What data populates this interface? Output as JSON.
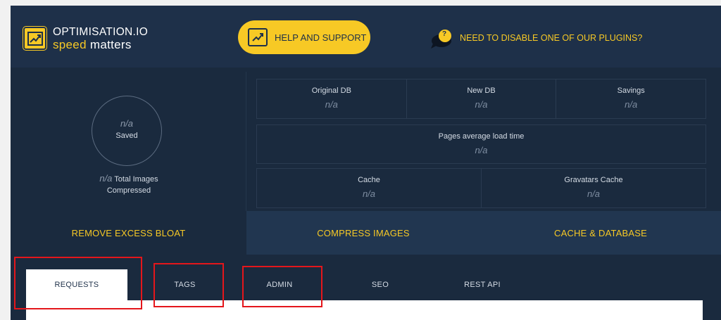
{
  "header": {
    "logo_top": "OPTIMISATION.IO",
    "logo_speed": "speed",
    "logo_matters": "matters",
    "help_label": "HELP AND SUPPORT",
    "disable_label": "NEED TO DISABLE ONE OF OUR PLUGINS?",
    "disable_icon_glyph": "?"
  },
  "stats": {
    "saved_value": "n/a",
    "saved_label": "Saved",
    "images_value": "n/a",
    "images_label_1": "Total Images",
    "images_label_2": "Compressed",
    "db": [
      {
        "label": "Original DB",
        "value": "n/a"
      },
      {
        "label": "New DB",
        "value": "n/a"
      },
      {
        "label": "Savings",
        "value": "n/a"
      }
    ],
    "load": {
      "label": "Pages average load time",
      "value": "n/a"
    },
    "cache": [
      {
        "label": "Cache",
        "value": "n/a"
      },
      {
        "label": "Gravatars Cache",
        "value": "n/a"
      }
    ]
  },
  "main_tabs": [
    {
      "label": "REMOVE EXCESS BLOAT",
      "active": true
    },
    {
      "label": "COMPRESS IMAGES",
      "active": false
    },
    {
      "label": "CACHE & DATABASE",
      "active": false
    }
  ],
  "sub_tabs": [
    {
      "label": "REQUESTS",
      "active": true
    },
    {
      "label": "TAGS",
      "active": false
    },
    {
      "label": "ADMIN",
      "active": false
    },
    {
      "label": "SEO",
      "active": false
    },
    {
      "label": "REST API",
      "active": false
    }
  ],
  "colors": {
    "accent": "#f7c925",
    "panel_bg": "#1a2a3e",
    "header_bg": "#1e3049",
    "annotation": "#e4161b"
  }
}
